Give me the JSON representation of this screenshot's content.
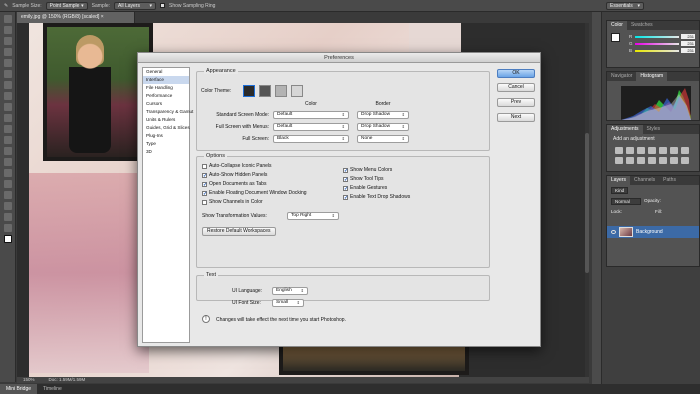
{
  "options_bar": {
    "sample_size_label": "Sample Size:",
    "sample_size_value": "Point Sample",
    "sample_label": "Sample:",
    "sample_value": "All Layers",
    "show_ring_label": "Show Sampling Ring",
    "workspace": "Essentials"
  },
  "document": {
    "tab_title": "emily.jpg @ 150% (RGB/8) [scaled]",
    "zoom": "150%",
    "doc_info": "Doc: 1.59M/1.59M"
  },
  "bottom_tabs": [
    "Mini Bridge",
    "Timeline"
  ],
  "right_panels": {
    "color_tabs": [
      "Color",
      "Swatches"
    ],
    "color_values": [
      "231",
      "231",
      "231"
    ],
    "color_labels": [
      "R",
      "G",
      "B"
    ],
    "nav_tabs": [
      "Navigator",
      "Histogram"
    ],
    "adj_tabs": [
      "Adjustments",
      "Styles"
    ],
    "adj_header": "Add an adjustment",
    "layer_tabs": [
      "Layers",
      "Channels",
      "Paths"
    ],
    "layer_kind": "Kind",
    "blend_mode": "Normal",
    "opacity_label": "Opacity:",
    "lock_label": "Lock:",
    "fill_label": "Fill:",
    "layer_name": "Background"
  },
  "dialog": {
    "title": "Preferences",
    "categories": [
      "General",
      "Interface",
      "File Handling",
      "Performance",
      "Cursors",
      "Transparency & Gamut",
      "Units & Rulers",
      "Guides, Grid & Slices",
      "Plug-Ins",
      "Type",
      "3D"
    ],
    "selected_category": "Interface",
    "buttons": {
      "ok": "OK",
      "cancel": "Cancel",
      "prev": "Prev",
      "next": "Next"
    },
    "appearance": {
      "title": "Appearance",
      "color_theme_label": "Color Theme:",
      "color_header": "Color",
      "border_header": "Border",
      "rows": [
        {
          "label": "Standard Screen Mode:",
          "color": "Default",
          "border": "Drop Shadow"
        },
        {
          "label": "Full Screen with Menus:",
          "color": "Default",
          "border": "Drop Shadow"
        },
        {
          "label": "Full Screen:",
          "color": "Black",
          "border": "None"
        }
      ],
      "theme_colors": [
        "#2b2b2b",
        "#555555",
        "#b3b3b3",
        "#d6d6d6"
      ]
    },
    "options": {
      "title": "Options",
      "left": [
        {
          "label": "Auto-Collapse Iconic Panels",
          "checked": false
        },
        {
          "label": "Auto-Show Hidden Panels",
          "checked": true
        },
        {
          "label": "Open Documents as Tabs",
          "checked": true
        },
        {
          "label": "Enable Floating Document Window Docking",
          "checked": true
        },
        {
          "label": "Show Channels in Color",
          "checked": false
        }
      ],
      "right": [
        {
          "label": "Show Menu Colors",
          "checked": true
        },
        {
          "label": "Show Tool Tips",
          "checked": true
        },
        {
          "label": "Enable Gestures",
          "checked": true
        },
        {
          "label": "Enable Text Drop Shadows",
          "checked": true
        }
      ],
      "transform_label": "Show Transformation Values:",
      "transform_value": "Top Right",
      "restore_button": "Restore Default Workspaces"
    },
    "text": {
      "title": "Text",
      "ui_language_label": "UI Language:",
      "ui_language_value": "English",
      "ui_font_label": "UI Font Size:",
      "ui_font_value": "Small",
      "notice": "Changes will take effect the next time you start Photoshop."
    }
  }
}
